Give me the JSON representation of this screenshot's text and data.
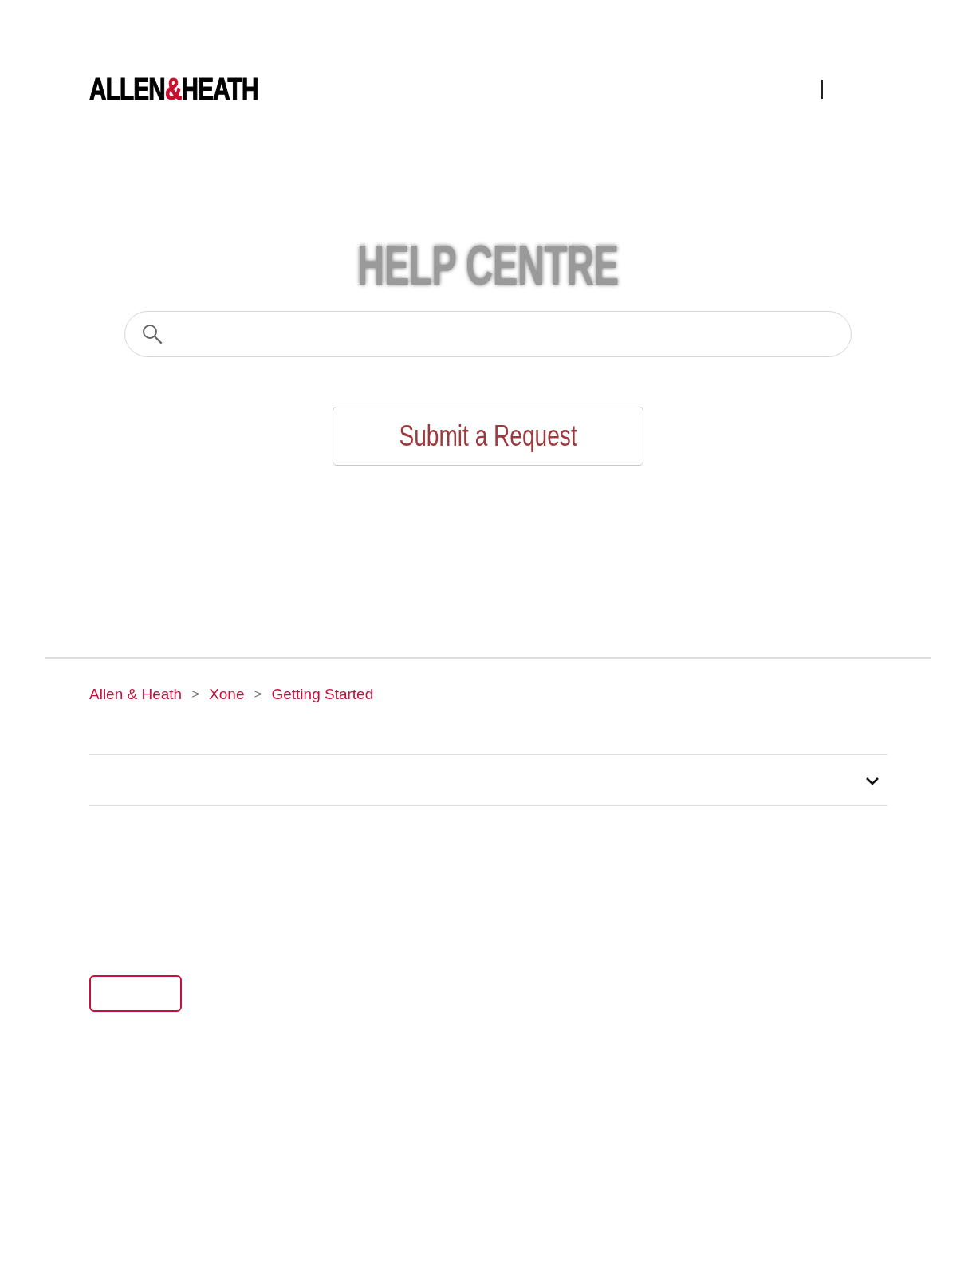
{
  "logo": {
    "parts": [
      {
        "text": "ALLEN",
        "accent": false
      },
      {
        "text": "&",
        "accent": true
      },
      {
        "text": "HEATH",
        "accent": false
      }
    ]
  },
  "hero": {
    "title": "HELP CENTRE",
    "button": "Submit a Request"
  },
  "breadcrumbs": [
    {
      "label": "Allen & Heath"
    },
    {
      "label": "Xone"
    },
    {
      "label": "Getting Started"
    }
  ],
  "breadcrumb_separator": ">",
  "accordion": {
    "expanded": false
  }
}
